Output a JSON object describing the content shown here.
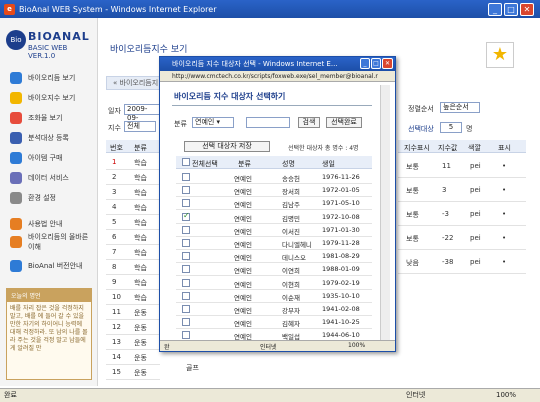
{
  "window": {
    "title": "BioAnal WEB System - Windows Internet Explorer",
    "min": "_",
    "max": "□",
    "close": "✕"
  },
  "logo": {
    "name": "BIOANAL",
    "sub": "BASIC WEB VER.1.0",
    "badge": "Bio"
  },
  "sidebar": {
    "items": [
      {
        "label": "바이오리듬 보기",
        "color": "#2e7bd6"
      },
      {
        "label": "바이오지수 보기",
        "color": "#f2b600"
      },
      {
        "label": "조화율 보기",
        "color": "#e74c3c"
      },
      {
        "label": "분석대상 등록",
        "color": "#3a5fb0"
      },
      {
        "label": "아이템 구매",
        "color": "#2e7bd6"
      },
      {
        "label": "데이터 서비스",
        "color": "#6a6fb8"
      },
      {
        "label": "환경 설정",
        "color": "#8a8a8a"
      },
      {
        "label": "사용법 안내",
        "color": "#e67e22"
      },
      {
        "label": "바이오리듬의 올바른 이해",
        "color": "#e67e22"
      },
      {
        "label": "BioAnal 버전안내",
        "color": "#2e7bd6"
      }
    ],
    "notice_title": "오늘의 명언",
    "notice_text": "배를 자리 잡은 것을 걱정하지 말고, 배를 에 들어 갈 수 있을 만한 자기의 하이어니 능력에 대해 걱정하라. 또 남의 나를 몰라 주는 것을 걱정 말고 남들에게 알려질 만"
  },
  "page": {
    "title": "바이오리듬지수 보기",
    "tab": "« 바이오리듬지",
    "date_label": "일자",
    "date_value": "2009-09-",
    "index_label": "지수",
    "index_value": "전체",
    "sort_label": "정렬순서",
    "sort_value": "높은순서",
    "target_label": "선택대상",
    "target_value": "5",
    "target_unit": "명"
  },
  "left_table": {
    "headers": [
      "번호",
      "분류"
    ],
    "rows": [
      {
        "no": "1",
        "cat": "학습"
      },
      {
        "no": "2",
        "cat": "학습"
      },
      {
        "no": "3",
        "cat": "학습"
      },
      {
        "no": "4",
        "cat": "학습"
      },
      {
        "no": "5",
        "cat": "학습"
      },
      {
        "no": "6",
        "cat": "학습"
      },
      {
        "no": "7",
        "cat": "학습"
      },
      {
        "no": "8",
        "cat": "학습"
      },
      {
        "no": "9",
        "cat": "학습"
      },
      {
        "no": "10",
        "cat": "학습"
      },
      {
        "no": "11",
        "cat": "운동"
      },
      {
        "no": "12",
        "cat": "운동"
      },
      {
        "no": "13",
        "cat": "운동"
      },
      {
        "no": "14",
        "cat": "운동"
      },
      {
        "no": "15",
        "cat": "운동"
      }
    ],
    "extra_bottom": "골프"
  },
  "right_table": {
    "headers": [
      "지수표시",
      "지수값",
      "색깔",
      "표시"
    ],
    "rows": [
      {
        "label": "보통",
        "value": "11",
        "color": "pei",
        "mark": "•"
      },
      {
        "label": "보통",
        "value": "3",
        "color": "pei",
        "mark": "•"
      },
      {
        "label": "보통",
        "value": "-3",
        "color": "pei",
        "mark": "•"
      },
      {
        "label": "보통",
        "value": "-22",
        "color": "pei",
        "mark": "•"
      },
      {
        "label": "낮음",
        "value": "-38",
        "color": "pei",
        "mark": "•"
      }
    ]
  },
  "popup": {
    "title": "바이오리듬 지수 대상자 선택 - Windows Internet E...",
    "url": "http://www.cmctech.co.kr/scripts/foxweb.exe/sel_member@bioanal.r",
    "heading": "바이오리듬 지수 대상자 선택하기",
    "filter_label": "분류",
    "filter_value": "연예인 ▾",
    "search_btn": "검색",
    "select_done_btn": "선택완료",
    "save_btn": "선택 대상자 저장",
    "selected_text": "선택한 대상자 총 명수 : 4명",
    "headers": [
      "전체선택",
      "분류",
      "성명",
      "생일"
    ],
    "rows": [
      {
        "checked": false,
        "cat": "연예인",
        "name": "송승헌",
        "birth": "1976-11-26"
      },
      {
        "checked": false,
        "cat": "연예인",
        "name": "장서희",
        "birth": "1972-01-05"
      },
      {
        "checked": false,
        "cat": "연예인",
        "name": "김남주",
        "birth": "1971-05-10"
      },
      {
        "checked": true,
        "cat": "연예인",
        "name": "김명민",
        "birth": "1972-10-08"
      },
      {
        "checked": false,
        "cat": "연예인",
        "name": "이서진",
        "birth": "1971-01-30"
      },
      {
        "checked": false,
        "cat": "연예인",
        "name": "다니엘헤니",
        "birth": "1979-11-28"
      },
      {
        "checked": false,
        "cat": "연예인",
        "name": "데니스오",
        "birth": "1981-08-29"
      },
      {
        "checked": false,
        "cat": "연예인",
        "name": "이연희",
        "birth": "1988-01-09"
      },
      {
        "checked": false,
        "cat": "연예인",
        "name": "이현희",
        "birth": "1979-02-19"
      },
      {
        "checked": false,
        "cat": "연예인",
        "name": "이순재",
        "birth": "1935-10-10"
      },
      {
        "checked": false,
        "cat": "연예인",
        "name": "강부자",
        "birth": "1941-02-08"
      },
      {
        "checked": false,
        "cat": "연예인",
        "name": "김혜자",
        "birth": "1941-10-25"
      },
      {
        "checked": false,
        "cat": "연예인",
        "name": "백일섭",
        "birth": "1944-06-10"
      }
    ],
    "status_left": "완",
    "status_zone": "인터넷",
    "status_zoom": "100%"
  },
  "statusbar": {
    "left": "완료",
    "zone": "인터넷",
    "zoom": "100%"
  }
}
